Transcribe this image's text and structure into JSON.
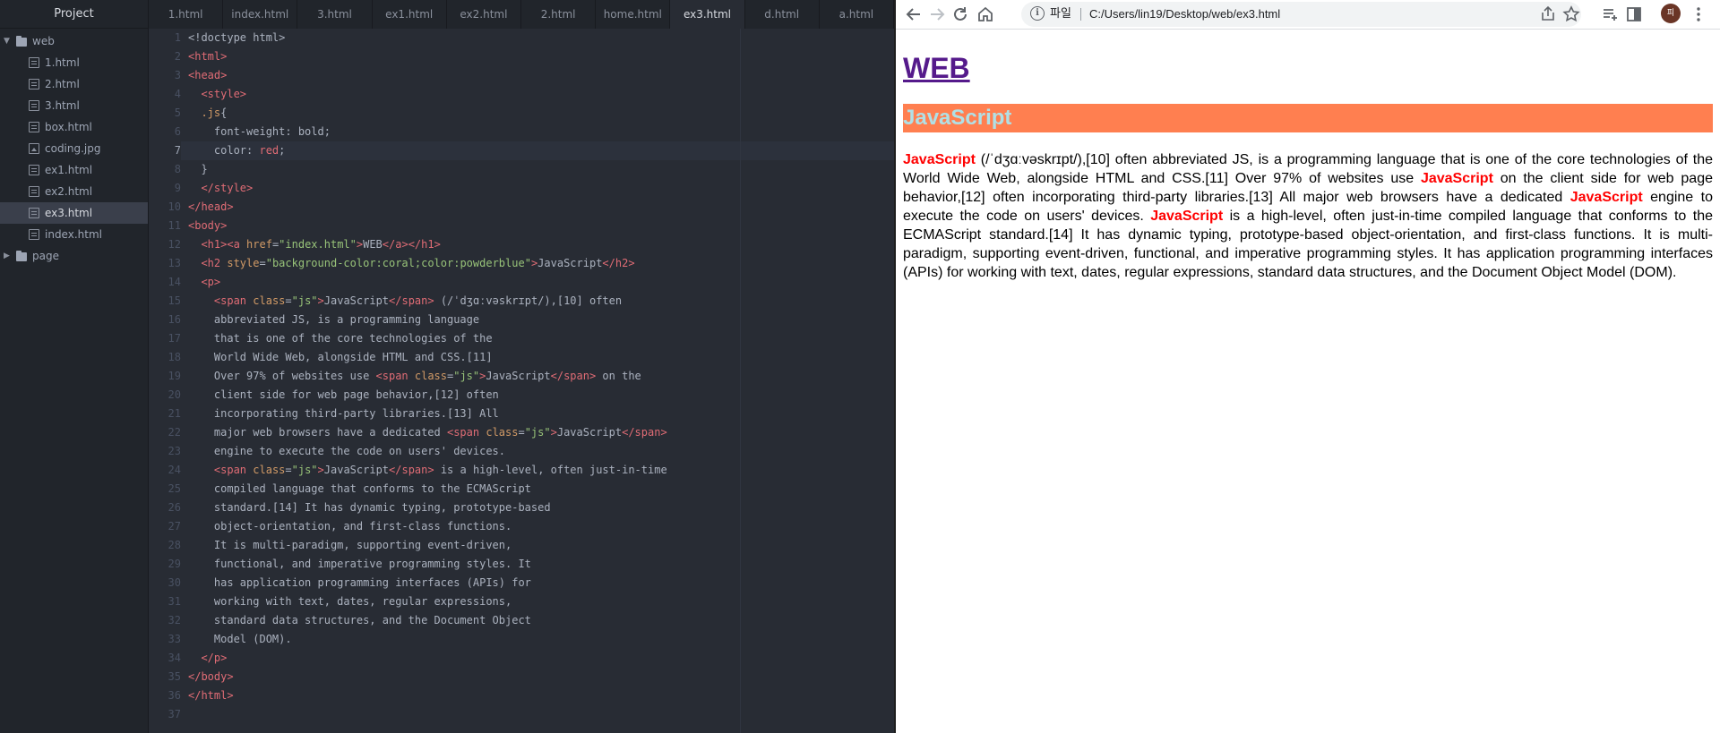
{
  "editor": {
    "tree_title": "Project",
    "tree": [
      {
        "kind": "folder",
        "open": true,
        "depth": 0,
        "label": "web",
        "selected": false
      },
      {
        "kind": "file",
        "depth": 1,
        "label": "1.html",
        "selected": false
      },
      {
        "kind": "file",
        "depth": 1,
        "label": "2.html",
        "selected": false
      },
      {
        "kind": "file",
        "depth": 1,
        "label": "3.html",
        "selected": false
      },
      {
        "kind": "file",
        "depth": 1,
        "label": "box.html",
        "selected": false
      },
      {
        "kind": "image",
        "depth": 1,
        "label": "coding.jpg",
        "selected": false
      },
      {
        "kind": "file",
        "depth": 1,
        "label": "ex1.html",
        "selected": false
      },
      {
        "kind": "file",
        "depth": 1,
        "label": "ex2.html",
        "selected": false
      },
      {
        "kind": "file",
        "depth": 1,
        "label": "ex3.html",
        "selected": true
      },
      {
        "kind": "file",
        "depth": 1,
        "label": "index.html",
        "selected": false
      },
      {
        "kind": "folder",
        "open": false,
        "depth": 0,
        "label": "page",
        "selected": false
      }
    ],
    "tabs": [
      {
        "label": "1.html",
        "active": false
      },
      {
        "label": "index.html",
        "active": false
      },
      {
        "label": "3.html",
        "active": false
      },
      {
        "label": "ex1.html",
        "active": false
      },
      {
        "label": "ex2.html",
        "active": false
      },
      {
        "label": "2.html",
        "active": false
      },
      {
        "label": "home.html",
        "active": false
      },
      {
        "label": "ex3.html",
        "active": true
      },
      {
        "label": "d.html",
        "active": false
      },
      {
        "label": "a.html",
        "active": false
      }
    ],
    "cursor_line": 7,
    "code_lines": [
      [
        [
          "p",
          "<!doctype html>"
        ]
      ],
      [
        [
          "t",
          "<html>"
        ]
      ],
      [
        [
          "t",
          "<head>"
        ]
      ],
      [
        [
          "p",
          "  "
        ],
        [
          "t",
          "<style>"
        ]
      ],
      [
        [
          "p",
          "  "
        ],
        [
          "cls",
          ".js"
        ],
        [
          "p",
          "{"
        ]
      ],
      [
        [
          "p",
          "    "
        ],
        [
          "pr",
          "font-weight: bold;"
        ]
      ],
      [
        [
          "p",
          "    "
        ],
        [
          "pr",
          "color: "
        ],
        [
          "v",
          "red"
        ],
        [
          "p",
          ";"
        ]
      ],
      [
        [
          "p",
          "  }"
        ]
      ],
      [
        [
          "p",
          "  "
        ],
        [
          "t",
          "</style>"
        ]
      ],
      [
        [
          "t",
          "</head>"
        ]
      ],
      [
        [
          "t",
          "<body>"
        ]
      ],
      [
        [
          "p",
          "  "
        ],
        [
          "t",
          "<h1><a "
        ],
        [
          "a",
          "href"
        ],
        [
          "p",
          "="
        ],
        [
          "s",
          "\"index.html\""
        ],
        [
          "t",
          ">"
        ],
        [
          "p",
          "WEB"
        ],
        [
          "t",
          "</a></h1>"
        ]
      ],
      [
        [
          "p",
          "  "
        ],
        [
          "t",
          "<h2 "
        ],
        [
          "a",
          "style"
        ],
        [
          "p",
          "="
        ],
        [
          "s",
          "\"background-color:coral;color:powderblue\""
        ],
        [
          "t",
          ">"
        ],
        [
          "p",
          "JavaScript"
        ],
        [
          "t",
          "</h2>"
        ]
      ],
      [
        [
          "p",
          "  "
        ],
        [
          "t",
          "<p>"
        ]
      ],
      [
        [
          "p",
          "    "
        ],
        [
          "t",
          "<span "
        ],
        [
          "a",
          "class"
        ],
        [
          "p",
          "="
        ],
        [
          "s",
          "\"js\""
        ],
        [
          "t",
          ">"
        ],
        [
          "p",
          "JavaScript"
        ],
        [
          "t",
          "</span>"
        ],
        [
          "p",
          " (/ˈdʒɑːvəskrɪpt/),[10] often"
        ]
      ],
      [
        [
          "p",
          "    abbreviated JS, is a programming language"
        ]
      ],
      [
        [
          "p",
          "    that is one of the core technologies of the"
        ]
      ],
      [
        [
          "p",
          "    World Wide Web, alongside HTML and CSS.[11]"
        ]
      ],
      [
        [
          "p",
          "    Over 97% of websites use "
        ],
        [
          "t",
          "<span "
        ],
        [
          "a",
          "class"
        ],
        [
          "p",
          "="
        ],
        [
          "s",
          "\"js\""
        ],
        [
          "t",
          ">"
        ],
        [
          "p",
          "JavaScript"
        ],
        [
          "t",
          "</span>"
        ],
        [
          "p",
          " on the"
        ]
      ],
      [
        [
          "p",
          "    client side for web page behavior,[12] often"
        ]
      ],
      [
        [
          "p",
          "    incorporating third-party libraries.[13] All"
        ]
      ],
      [
        [
          "p",
          "    major web browsers have a dedicated "
        ],
        [
          "t",
          "<span "
        ],
        [
          "a",
          "class"
        ],
        [
          "p",
          "="
        ],
        [
          "s",
          "\"js\""
        ],
        [
          "t",
          ">"
        ],
        [
          "p",
          "JavaScript"
        ],
        [
          "t",
          "</span>"
        ]
      ],
      [
        [
          "p",
          "    engine to execute the code on users' devices."
        ]
      ],
      [
        [
          "p",
          "    "
        ],
        [
          "t",
          "<span "
        ],
        [
          "a",
          "class"
        ],
        [
          "p",
          "="
        ],
        [
          "s",
          "\"js\""
        ],
        [
          "t",
          ">"
        ],
        [
          "p",
          "JavaScript"
        ],
        [
          "t",
          "</span>"
        ],
        [
          "p",
          " is a high-level, often just-in-time"
        ]
      ],
      [
        [
          "p",
          "    compiled language that conforms to the ECMAScript"
        ]
      ],
      [
        [
          "p",
          "    standard.[14] It has dynamic typing, prototype-based"
        ]
      ],
      [
        [
          "p",
          "    object-orientation, and first-class functions."
        ]
      ],
      [
        [
          "p",
          "    It is multi-paradigm, supporting event-driven,"
        ]
      ],
      [
        [
          "p",
          "    functional, and imperative programming styles. It"
        ]
      ],
      [
        [
          "p",
          "    has application programming interfaces (APIs) for"
        ]
      ],
      [
        [
          "p",
          "    working with text, dates, regular expressions,"
        ]
      ],
      [
        [
          "p",
          "    standard data structures, and the Document Object"
        ]
      ],
      [
        [
          "p",
          "    Model (DOM)."
        ]
      ],
      [
        [
          "p",
          "  "
        ],
        [
          "t",
          "</p>"
        ]
      ],
      [
        [
          "t",
          "</body>"
        ]
      ],
      [
        [
          "t",
          "</html>"
        ]
      ],
      [
        [
          "p",
          ""
        ]
      ]
    ]
  },
  "browser": {
    "nav": {
      "back_icon": "arrow-left-icon",
      "forward_icon": "arrow-right-icon",
      "reload_icon": "reload-icon",
      "home_icon": "home-icon"
    },
    "address": {
      "scheme_label": "파일",
      "url": "C:/Users/lin19/Desktop/web/ex3.html"
    },
    "avatar_text": "피",
    "page": {
      "h1_link": "WEB",
      "h2": "JavaScript",
      "paragraph": [
        {
          "js": true,
          "text": "JavaScript"
        },
        {
          "js": false,
          "text": " (/ˈdʒɑːvəskrɪpt/),[10] often abbreviated JS, is a programming language that is one of the core technologies of the World Wide Web, alongside HTML and CSS.[11] Over 97% of websites use "
        },
        {
          "js": true,
          "text": "JavaScript"
        },
        {
          "js": false,
          "text": " on the client side for web page behavior,[12] often incorporating third-party libraries.[13] All major web browsers have a dedicated "
        },
        {
          "js": true,
          "text": "JavaScript"
        },
        {
          "js": false,
          "text": " engine to execute the code on users' devices. "
        },
        {
          "js": true,
          "text": "JavaScript"
        },
        {
          "js": false,
          "text": " is a high-level, often just-in-time compiled language that conforms to the ECMAScript standard.[14] It has dynamic typing, prototype-based object-orientation, and first-class functions. It is multi-paradigm, supporting event-driven, functional, and imperative programming styles. It has application programming interfaces (APIs) for working with text, dates, regular expressions, standard data structures, and the Document Object Model (DOM)."
        }
      ]
    }
  }
}
